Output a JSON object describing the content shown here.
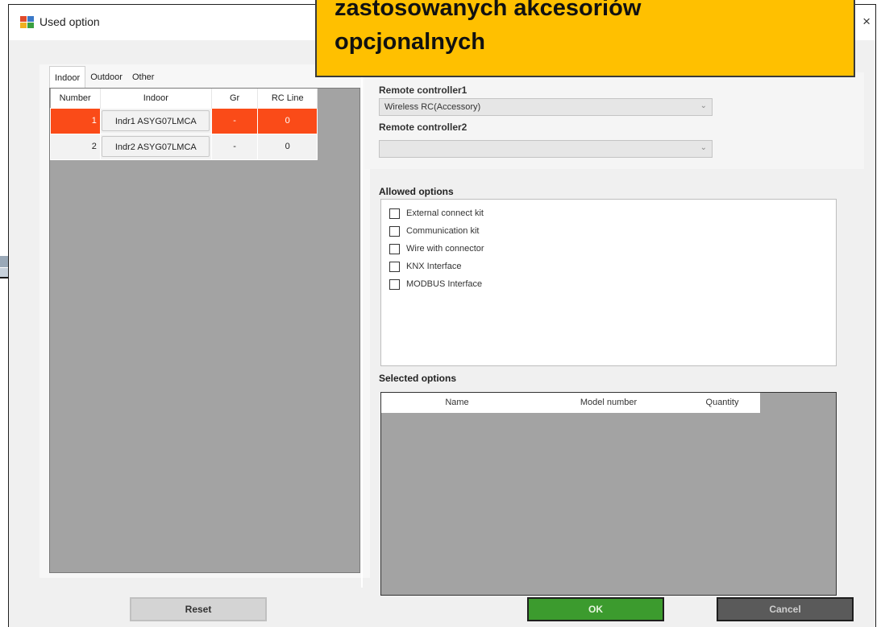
{
  "window": {
    "title": "Used option",
    "close_glyph": "×"
  },
  "callout": {
    "line1": "zastosowanych akcesoriów",
    "line2": "opcjonalnych"
  },
  "tabs": [
    {
      "label": "Indoor",
      "active": true
    },
    {
      "label": "Outdoor",
      "active": false
    },
    {
      "label": "Other",
      "active": false
    }
  ],
  "indoor_grid": {
    "columns": [
      "Number",
      "Indoor",
      "Gr",
      "RC Line"
    ],
    "rows": [
      {
        "number": "1",
        "indoor": "Indr1 ASYG07LMCA",
        "gr": "-",
        "rc_line": "0",
        "selected": true
      },
      {
        "number": "2",
        "indoor": "Indr2 ASYG07LMCA",
        "gr": "-",
        "rc_line": "0",
        "selected": false
      }
    ]
  },
  "remote": {
    "rc1_label": "Remote controller1",
    "rc1_value": "Wireless RC(Accessory)",
    "rc2_label": "Remote controller2",
    "rc2_value": ""
  },
  "allowed": {
    "label": "Allowed options",
    "options": [
      {
        "label": "External connect kit",
        "checked": false
      },
      {
        "label": "Communication kit",
        "checked": false
      },
      {
        "label": "Wire with connector",
        "checked": false
      },
      {
        "label": "KNX Interface",
        "checked": false
      },
      {
        "label": "MODBUS Interface",
        "checked": false
      }
    ]
  },
  "selected": {
    "label": "Selected options",
    "columns": [
      "Name",
      "Model number",
      "Quantity"
    ]
  },
  "buttons": {
    "reset": "Reset",
    "ok": "OK",
    "cancel": "Cancel"
  },
  "colors": {
    "selected_row": "#fa4b18",
    "callout": "#ffc000",
    "ok_button": "#3c9b2e",
    "grid_bg": "#a3a3a3"
  }
}
